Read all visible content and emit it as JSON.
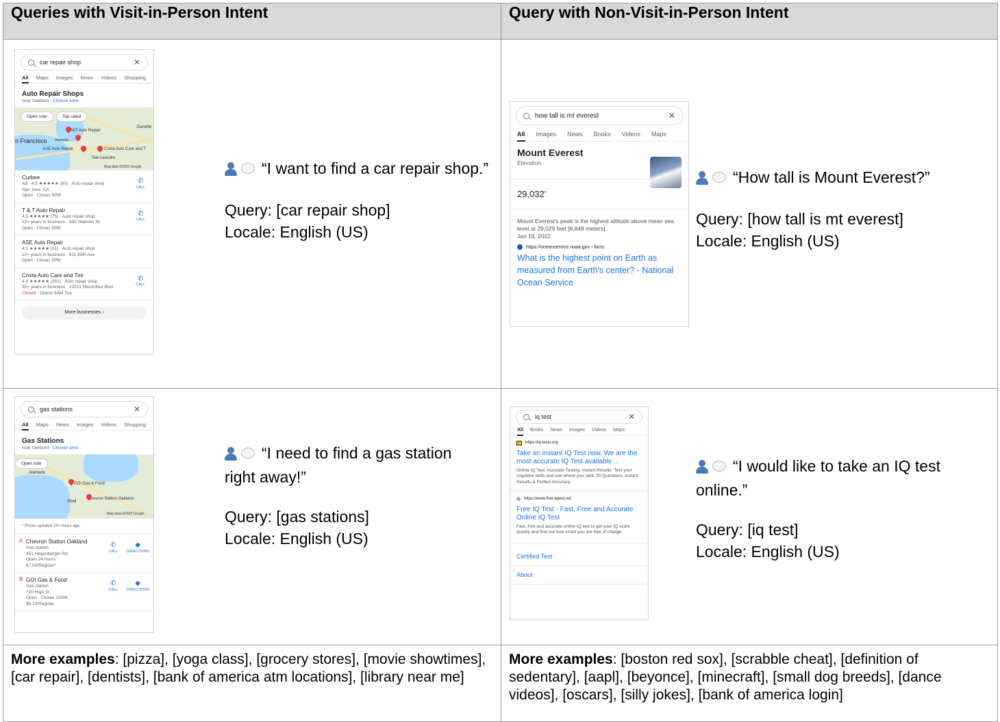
{
  "headers": {
    "left": "Queries with Visit-in-Person Intent",
    "right": "Query with Non-Visit-in-Person Intent"
  },
  "examples": [
    {
      "id": "car",
      "quote": "“I want to find a car repair shop.”",
      "query": "Query: [car repair shop]",
      "locale": "Locale: English (US)",
      "phone": {
        "search": "car repair shop",
        "tabs": [
          "All",
          "Maps",
          "Images",
          "News",
          "Videos",
          "Shopping"
        ],
        "title": "Auto Repair Shops",
        "subtitle_prefix": "near Oakland · ",
        "subtitle_link": "Choose area",
        "chips": [
          "Open now",
          "Top rated"
        ],
        "map_labels": [
          "n Francisco",
          "P&T Auto Repair",
          "ASE Auto Repair",
          "Costa Auto Care and T",
          "San Leandro",
          "Danville",
          "Map data ©2022 Google",
          "Alameda"
        ],
        "listings": [
          {
            "name": "Curbee",
            "line1": "Ad · 4.5 ★★★★★ (50) · Auto repair shop",
            "line2": "San Jose, CA",
            "line3": "Open · Closes 5PM"
          },
          {
            "name": "T & T Auto Repair",
            "line1": "4.5 ★★★★★ (75) · Auto repair shop",
            "line2": "10+ years in business · 330 Webster St",
            "line3": "Open · Closes 5PM"
          },
          {
            "name": "ASE Auto Repair",
            "line1": "4.5 ★★★★★ (51) · Auto repair shop",
            "line2": "10+ years in business · 611 85th Ave",
            "line3": "Open · Closes 5PM"
          },
          {
            "name": "Costa Auto Care and Tire",
            "line1": "4.8 ★★★★★ (351) · Auto repair shop",
            "line2": "35+ years in business · 10201 MacArthur Blvd",
            "line3_closed": "Closed",
            "line3": " · Opens 8AM Tue"
          }
        ],
        "call_label": "CALL",
        "more": "More businesses  ›"
      }
    },
    {
      "id": "everest",
      "quote": "“How tall is Mount Everest?”",
      "query": "Query: [how tall is mt everest]",
      "locale": "Locale: English (US)",
      "phone": {
        "search": "how tall is mt everest",
        "tabs": [
          "All",
          "Images",
          "News",
          "Books",
          "Videos",
          "Maps"
        ],
        "title": "Mount Everest",
        "subtitle": "Elevation",
        "value": "29,032'",
        "desc": "Mount Everest's peak is the highest altitude above mean sea level at 29,029 feet [8,848 meters].",
        "date": "Jan 19, 2022",
        "source": "https://oceanservice.noaa.gov › facts",
        "link": "What is the highest point on Earth as measured from Earth's center? - National Ocean Service"
      }
    },
    {
      "id": "gas",
      "quote": "“I need to find a gas station right away!”",
      "query": "Query: [gas stations]",
      "locale": "Locale: English (US)",
      "phone": {
        "search": "gas stations",
        "tabs": [
          "All",
          "Maps",
          "News",
          "Images",
          "Videos",
          "Shopping"
        ],
        "title": "Gas Stations",
        "subtitle_prefix": "near Oakland · ",
        "subtitle_link": "Choose area",
        "chips": [
          "Open now"
        ],
        "map_labels": [
          "Alameda",
          "GO! Gas & Food",
          "Shell",
          "Chevron Station Oakland",
          "Map data ©2022 Google"
        ],
        "note": "* Prices updated 24+ hours ago",
        "listings": [
          {
            "letter": "A",
            "name": "Chevron Station Oakland",
            "line1": "Gas station",
            "line2": "451 Hegenberger Rd",
            "line3": "Open 24 hours",
            "line4": "$7.00/Regular*"
          },
          {
            "letter": "B",
            "name": "GO! Gas & Food",
            "line1": "Gas station",
            "line2": "720 High St",
            "line3": "Open · Closes 12AM",
            "line4": "$6.10/Regular"
          }
        ],
        "call_label": "CALL",
        "dir_label": "DIRECTIONS"
      }
    },
    {
      "id": "iq",
      "quote": "“I would like to take an IQ test online.”",
      "query": "Query: [iq test]",
      "locale": "Locale: English (US)",
      "phone": {
        "search": "iq test",
        "tabs": [
          "All",
          "Books",
          "News",
          "Images",
          "Videos",
          "Maps"
        ],
        "results": [
          {
            "source": "https://iq-tests.org",
            "link": "Take an instant IQ Test now. We are the most accurate IQ Test available ...",
            "snippet": "Online IQ Test. Accurate Testing. Instant Results. Test your cognitive skills and see where you rank. 20 Questions, Instant Results & Perfect Accuracy."
          },
          {
            "source": "https://www.free-iqtest.net",
            "link": "Free IQ Test - Fast, Free and Accurate Online IQ Test",
            "snippet": "Fast, free and accurate online IQ test to get your IQ score quickly and find out how smart you are free of charge."
          }
        ],
        "sitelinks": [
          "Certified Test",
          "About"
        ]
      }
    }
  ],
  "more_examples": {
    "label": "More examples",
    "left": ": [pizza], [yoga class], [grocery stores], [movie showtimes], [car repair], [dentists], [bank of america atm locations], [library near me]",
    "right": ": [boston red sox], [scrabble cheat], [definition of sedentary], [aapl], [beyonce], [minecraft], [small dog breeds], [dance videos], [oscars], [silly jokes], [bank of america login]"
  }
}
